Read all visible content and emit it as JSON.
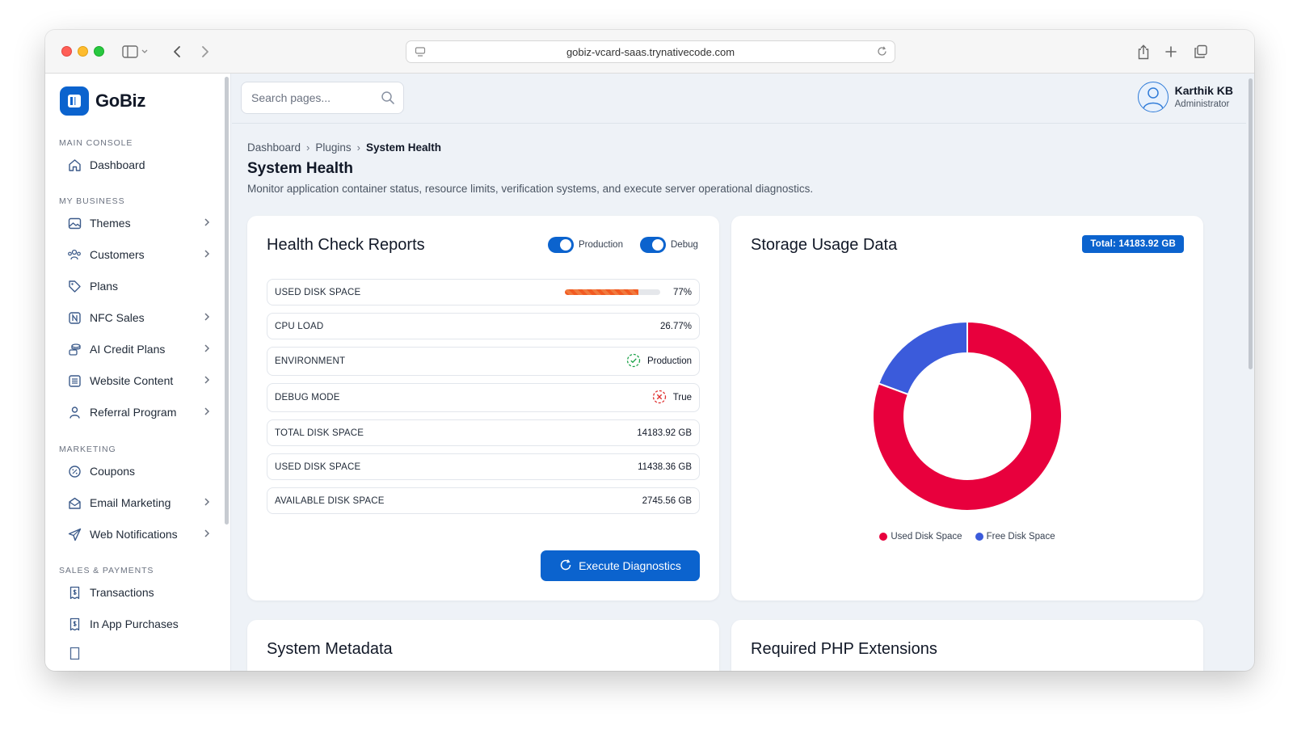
{
  "browser": {
    "url": "gobiz-vcard-saas.trynativecode.com"
  },
  "brand": {
    "name": "GoBiz"
  },
  "sidebar": {
    "sections": [
      {
        "label": "MAIN CONSOLE"
      },
      {
        "label": "MY BUSINESS"
      },
      {
        "label": "MARKETING"
      },
      {
        "label": "SALES & PAYMENTS"
      }
    ],
    "items": [
      {
        "label": "Dashboard",
        "icon": "home-icon"
      },
      {
        "label": "Themes",
        "icon": "image-icon"
      },
      {
        "label": "Customers",
        "icon": "users-icon"
      },
      {
        "label": "Plans",
        "icon": "tag-icon"
      },
      {
        "label": "NFC Sales",
        "icon": "nfc-icon"
      },
      {
        "label": "AI Credit Plans",
        "icon": "coins-icon"
      },
      {
        "label": "Website Content",
        "icon": "document-icon"
      },
      {
        "label": "Referral Program",
        "icon": "user-icon"
      },
      {
        "label": "Coupons",
        "icon": "discount-icon"
      },
      {
        "label": "Email Marketing",
        "icon": "mail-icon"
      },
      {
        "label": "Web Notifications",
        "icon": "send-icon"
      },
      {
        "label": "Transactions",
        "icon": "receipt-icon"
      },
      {
        "label": "In App Purchases",
        "icon": "receipt-icon"
      }
    ]
  },
  "search": {
    "placeholder": "Search pages..."
  },
  "user": {
    "name": "Karthik KB",
    "role": "Administrator"
  },
  "breadcrumb": {
    "items": [
      "Dashboard",
      "Plugins",
      "System Health"
    ]
  },
  "page": {
    "title": "System Health",
    "description": "Monitor application container status, resource limits, verification systems, and execute server operational diagnostics."
  },
  "health": {
    "title": "Health Check Reports",
    "toggles": [
      {
        "label": "Production",
        "on": true
      },
      {
        "label": "Debug",
        "on": true
      }
    ],
    "rows": [
      {
        "label": "USED DISK SPACE",
        "value": "77%",
        "progress": 77
      },
      {
        "label": "CPU LOAD",
        "value": "26.77%"
      },
      {
        "label": "ENVIRONMENT",
        "value": "Production",
        "status": "ok"
      },
      {
        "label": "DEBUG MODE",
        "value": "True",
        "status": "error"
      },
      {
        "label": "TOTAL DISK SPACE",
        "value": "14183.92 GB"
      },
      {
        "label": "USED DISK SPACE",
        "value": "11438.36 GB"
      },
      {
        "label": "AVAILABLE DISK SPACE",
        "value": "2745.56 GB"
      }
    ],
    "button_label": "Execute Diagnostics"
  },
  "storage": {
    "title": "Storage Usage Data",
    "badge": "Total: 14183.92 GB"
  },
  "chart_data": {
    "type": "pie",
    "categories": [
      "Used Disk Space",
      "Free Disk Space"
    ],
    "values": [
      11438.36,
      2745.56
    ],
    "colors": [
      "#e8003d",
      "#3b5bdb"
    ],
    "legend": "bottom"
  },
  "lower_cards": {
    "left_title": "System Metadata",
    "right_title": "Required PHP Extensions"
  },
  "colors": {
    "accent": "#0b63ce",
    "progress": "#f25a22"
  }
}
